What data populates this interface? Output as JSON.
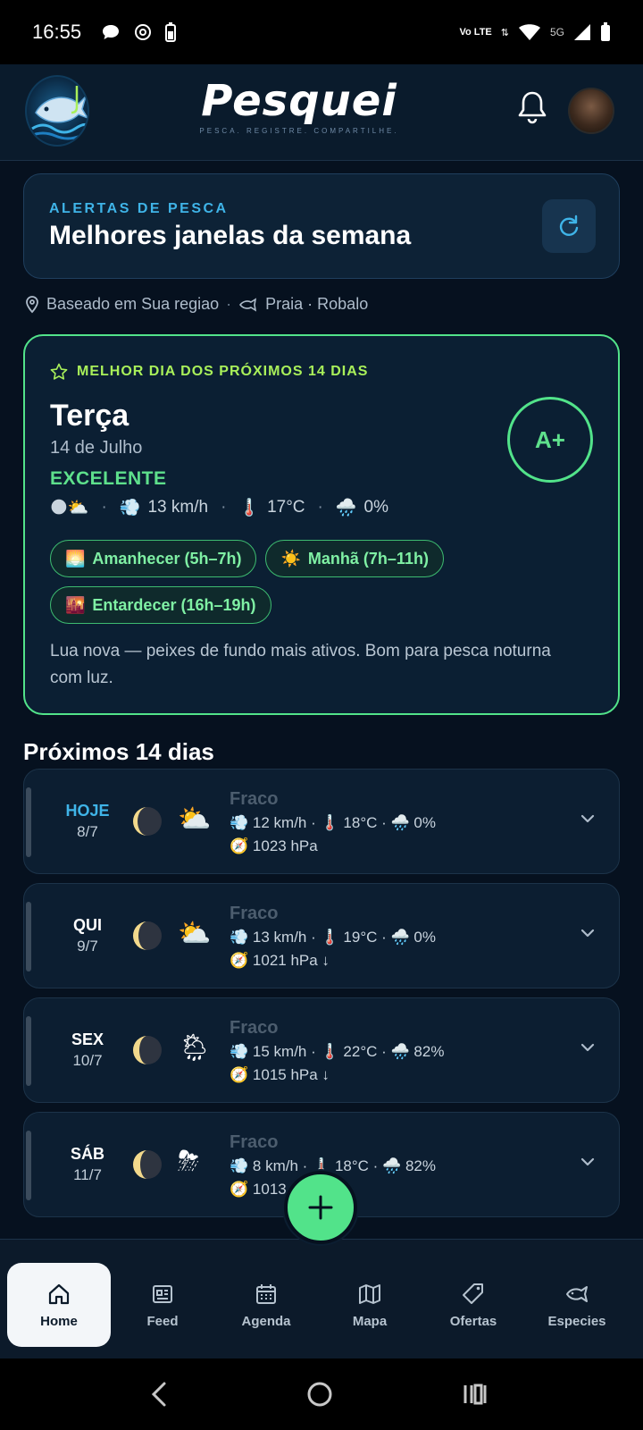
{
  "status_bar": {
    "time": "16:55",
    "network": "Vo LTE",
    "signal": "5G"
  },
  "header": {
    "brand": "Pesquei",
    "tagline": "PESCA. REGISTRE. COMPARTILHE."
  },
  "alert": {
    "kicker": "ALERTAS DE PESCA",
    "title": "Melhores janelas da semana"
  },
  "location": {
    "region": "Baseado em Sua regiao",
    "dot": "·",
    "spot": "Praia · Robalo"
  },
  "best": {
    "kicker": "MELHOR DIA DOS PRÓXIMOS 14 DIAS",
    "day": "Terça",
    "date": "14 de Julho",
    "rating": "EXCELENTE",
    "grade": "A+",
    "weather_icons": "🌑⛅",
    "wind": "13 km/h",
    "temp": "17°C",
    "rain": "0%",
    "chips": [
      {
        "icon": "🌅",
        "label": "Amanhecer (5h–7h)"
      },
      {
        "icon": "☀️",
        "label": "Manhã (7h–11h)"
      },
      {
        "icon": "🌇",
        "label": "Entardecer (16h–19h)"
      }
    ],
    "description": "Lua nova — peixes de fundo mais ativos. Bom para pesca noturna com luz."
  },
  "section_title": "Próximos 14 dias",
  "days": [
    {
      "name": "HOJE",
      "date": "8/7",
      "today": true,
      "weather": "⛅",
      "rating": "Fraco",
      "wind": "12 km/h",
      "temp": "18°C",
      "rain": "0%",
      "pressure": "1023 hPa"
    },
    {
      "name": "QUI",
      "date": "9/7",
      "today": false,
      "weather": "⛅",
      "rating": "Fraco",
      "wind": "13 km/h",
      "temp": "19°C",
      "rain": "0%",
      "pressure": "1021 hPa ↓"
    },
    {
      "name": "SEX",
      "date": "10/7",
      "today": false,
      "weather": "🌦",
      "rating": "Fraco",
      "wind": "15 km/h",
      "temp": "22°C",
      "rain": "82%",
      "pressure": "1015 hPa ↓"
    },
    {
      "name": "SÁB",
      "date": "11/7",
      "today": false,
      "weather": "⛈",
      "rating": "Fraco",
      "wind": "8 km/h",
      "temp": "18°C",
      "rain": "82%",
      "pressure": "1013 hPa"
    }
  ],
  "nav": [
    {
      "label": "Home",
      "icon": "home-icon"
    },
    {
      "label": "Feed",
      "icon": "newspaper-icon"
    },
    {
      "label": "Agenda",
      "icon": "calendar-icon"
    },
    {
      "label": "Mapa",
      "icon": "map-icon"
    },
    {
      "label": "Ofertas",
      "icon": "tag-icon"
    },
    {
      "label": "Especies",
      "icon": "fish-icon"
    }
  ],
  "colors": {
    "accent_green": "#52e38a",
    "accent_blue": "#3fb4e8",
    "background": "#06111f"
  }
}
